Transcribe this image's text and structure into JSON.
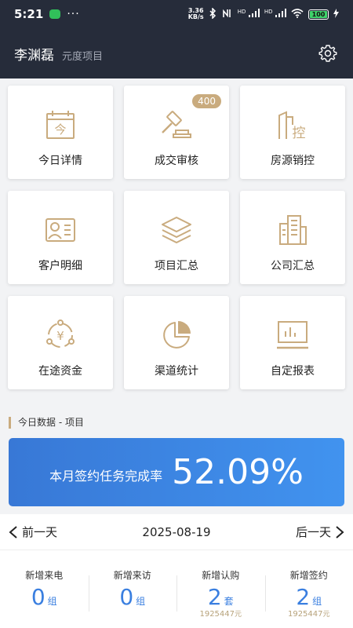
{
  "status_bar": {
    "time": "5:21",
    "dots": "···",
    "net_speed_value": "3.36",
    "net_speed_unit": "KB/s",
    "hd1": "HD",
    "hd2": "HD",
    "battery": "100"
  },
  "header": {
    "user_name": "李渊磊",
    "project_name": "元度项目"
  },
  "menu": [
    {
      "label": "今日详情",
      "icon": "calendar-today-icon"
    },
    {
      "label": "成交审核",
      "icon": "gavel-icon",
      "badge": "400"
    },
    {
      "label": "房源销控",
      "icon": "building-control-icon",
      "glyph": "控"
    },
    {
      "label": "客户明细",
      "icon": "customer-card-icon"
    },
    {
      "label": "项目汇总",
      "icon": "layers-icon"
    },
    {
      "label": "公司汇总",
      "icon": "office-building-icon"
    },
    {
      "label": "在途资金",
      "icon": "yuan-cycle-icon",
      "glyph": "¥"
    },
    {
      "label": "渠道统计",
      "icon": "pie-chart-icon"
    },
    {
      "label": "自定报表",
      "icon": "report-board-icon"
    }
  ],
  "section_title": "今日数据 - 项目",
  "banner": {
    "label": "本月签约任务完成率",
    "value": "52.09%"
  },
  "date_nav": {
    "prev": "前一天",
    "date": "2025-08-19",
    "next": "后一天"
  },
  "stats": [
    {
      "label": "新增来电",
      "value": "0",
      "unit": "组"
    },
    {
      "label": "新增来访",
      "value": "0",
      "unit": "组"
    },
    {
      "label": "新增认购",
      "value": "2",
      "unit": "套",
      "sub": "1925447",
      "sub_unit": "元"
    },
    {
      "label": "新增签约",
      "value": "2",
      "unit": "组",
      "sub": "1925447",
      "sub_unit": "元"
    }
  ],
  "colors": {
    "header_bg": "#262c3a",
    "accent_gold": "#c9ab7e",
    "banner_blue": "#3a82e4",
    "stat_blue": "#3a7fe0"
  }
}
